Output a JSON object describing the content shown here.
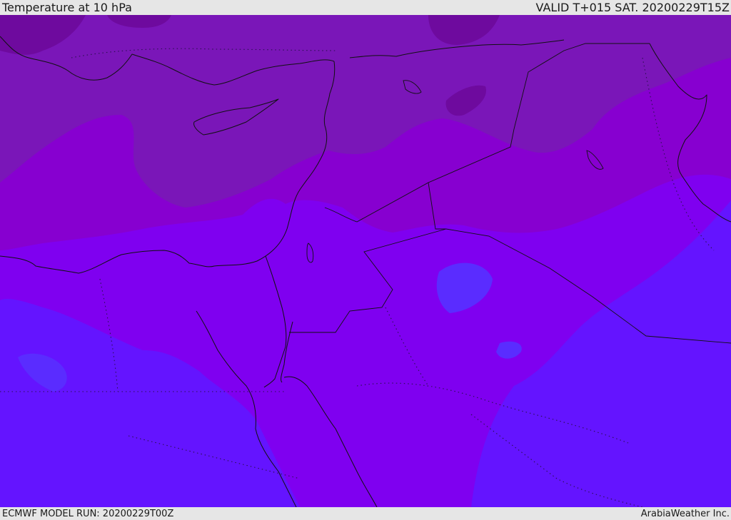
{
  "header": {
    "title": "Temperature at 10 hPa",
    "valid": "VALID T+015 SAT. 20200229T15Z"
  },
  "footer": {
    "model_run": "ECMWF MODEL RUN: 20200229T00Z",
    "credit": "ArabiaWeather Inc."
  },
  "colors": {
    "band_warm": "#7a16b8",
    "band_mid_dark": "#8700d0",
    "band_mid": "#7f00f0",
    "band_cool": "#6414ff",
    "band_cold_patch": "#5a2cff",
    "band_darkest": "#6e0a9e",
    "coastline": "#111111"
  }
}
